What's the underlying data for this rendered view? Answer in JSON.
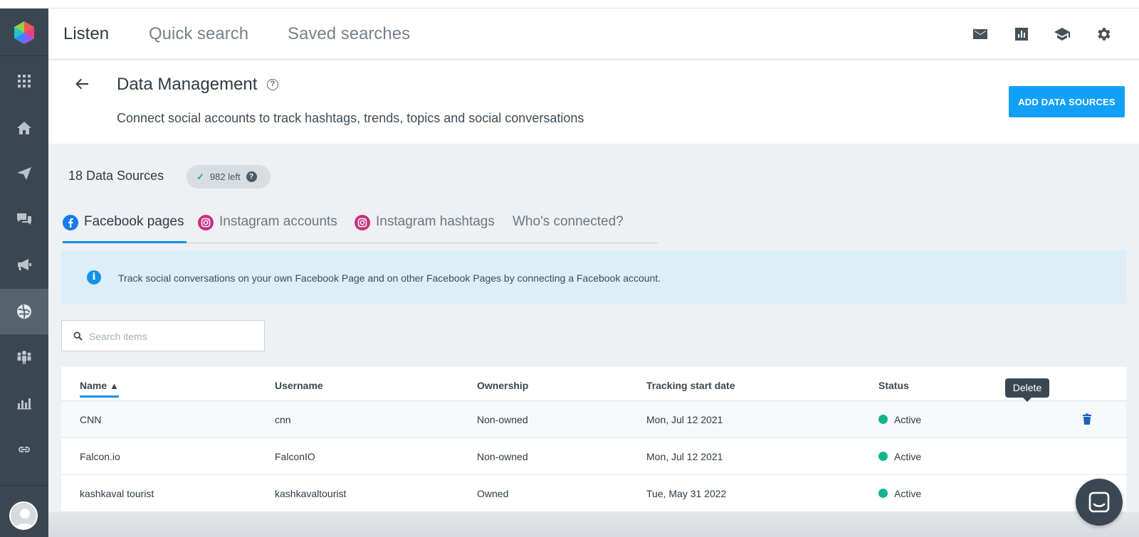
{
  "nav": {
    "tabs": [
      {
        "label": "Listen",
        "active": true
      },
      {
        "label": "Quick search",
        "active": false
      },
      {
        "label": "Saved searches",
        "active": false
      }
    ],
    "icons": [
      "mail-icon",
      "report-icon",
      "academy-icon",
      "settings-icon"
    ]
  },
  "sidebar": {
    "items": [
      "apps-icon",
      "home-icon",
      "publish-icon",
      "engage-icon",
      "advertise-icon",
      "listen-icon",
      "audience-icon",
      "measure-icon",
      "link-icon"
    ],
    "active_item": "listen-icon"
  },
  "header": {
    "title": "Data Management",
    "subtitle": "Connect social accounts to track hashtags, trends, topics and social conversations",
    "add_button": "ADD DATA SOURCES"
  },
  "sources": {
    "count_label": "18 Data Sources",
    "left_label": "982 left"
  },
  "tabs": [
    {
      "label": "Facebook pages",
      "icon": "facebook-icon",
      "active": true
    },
    {
      "label": "Instagram accounts",
      "icon": "instagram-icon",
      "active": false
    },
    {
      "label": "Instagram hashtags",
      "icon": "instagram-icon",
      "active": false
    },
    {
      "label": "Who's connected?",
      "icon": "",
      "active": false
    }
  ],
  "info": {
    "text": "Track social conversations on your own Facebook Page and on other Facebook Pages by connecting a Facebook account."
  },
  "search": {
    "placeholder": "Search items",
    "value": ""
  },
  "table": {
    "headers": [
      "Name",
      "Username",
      "Ownership",
      "Tracking start date",
      "Status"
    ],
    "sorted_column": "Name",
    "rows": [
      {
        "name": "CNN",
        "username": "cnn",
        "ownership": "Non-owned",
        "date": "Mon, Jul 12 2021",
        "status": "Active"
      },
      {
        "name": "Falcon.io",
        "username": "FalconIO",
        "ownership": "Non-owned",
        "date": "Mon, Jul 12 2021",
        "status": "Active"
      },
      {
        "name": "kashkaval tourist",
        "username": "kashkavaltourist",
        "ownership": "Owned",
        "date": "Tue, May 31 2022",
        "status": "Active"
      }
    ],
    "tooltip": "Delete"
  },
  "colors": {
    "accent": "#12a0f7",
    "sidebar": "#3b4750",
    "status_active": "#14b48a",
    "info_bg": "#dceef8"
  }
}
